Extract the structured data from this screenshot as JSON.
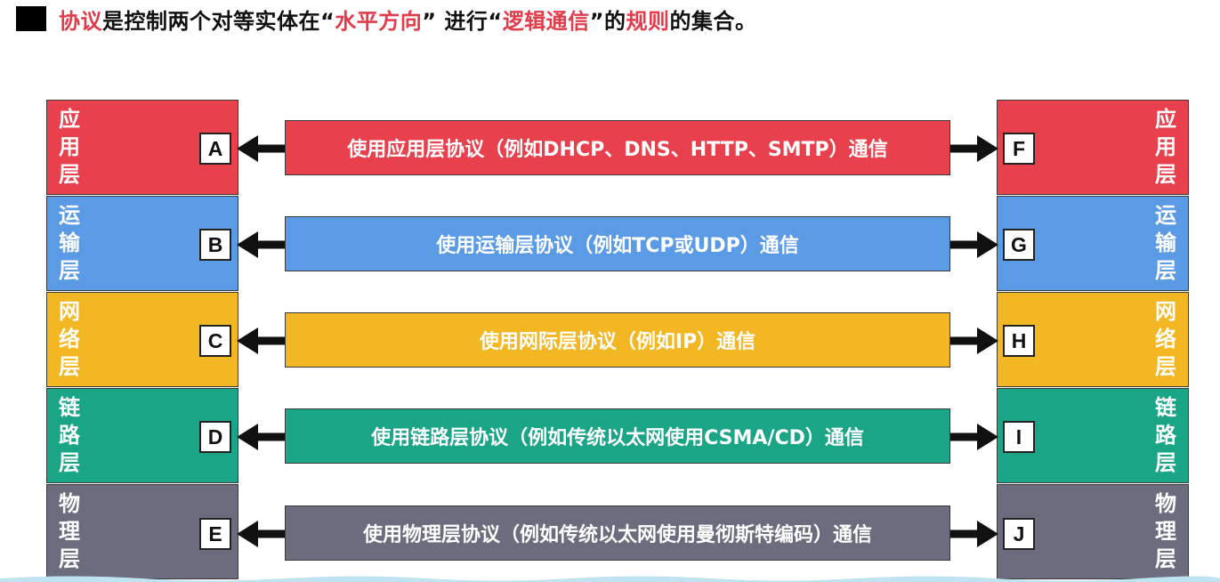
{
  "title": {
    "parts": [
      {
        "text": "协议",
        "highlight": true
      },
      {
        "text": "是控制两个对等实体在“",
        "highlight": false
      },
      {
        "text": "水平方向",
        "highlight": true
      },
      {
        "text": "” 进行“",
        "highlight": false
      },
      {
        "text": "逻辑通信",
        "highlight": true
      },
      {
        "text": "”的",
        "highlight": false
      },
      {
        "text": "规则",
        "highlight": true
      },
      {
        "text": "的集合。",
        "highlight": false
      }
    ],
    "highlight_color": "#e23b4a"
  },
  "layers": [
    {
      "id": "application",
      "name_chars": [
        "应",
        "用",
        "层"
      ],
      "color": "#e8414d",
      "left_box": "A",
      "right_box": "F",
      "protocol": "使用应用层协议（例如DHCP、DNS、HTTP、SMTP）通信"
    },
    {
      "id": "transport",
      "name_chars": [
        "运",
        "输",
        "层"
      ],
      "color": "#5b9be6",
      "left_box": "B",
      "right_box": "G",
      "protocol": "使用运输层协议（例如TCP或UDP）通信"
    },
    {
      "id": "network",
      "name_chars": [
        "网",
        "络",
        "层"
      ],
      "color": "#f2b722",
      "left_box": "C",
      "right_box": "H",
      "protocol": "使用网际层协议（例如IP）通信"
    },
    {
      "id": "link",
      "name_chars": [
        "链",
        "路",
        "层"
      ],
      "color": "#1aa587",
      "left_box": "D",
      "right_box": "I",
      "protocol": "使用链路层协议（例如传统以太网使用CSMA/CD）通信"
    },
    {
      "id": "physical",
      "name_chars": [
        "物",
        "理",
        "层"
      ],
      "color": "#6b6d7e",
      "left_box": "E",
      "right_box": "J",
      "protocol": "使用物理层协议（例如传统以太网使用曼彻斯特编码）通信"
    }
  ]
}
